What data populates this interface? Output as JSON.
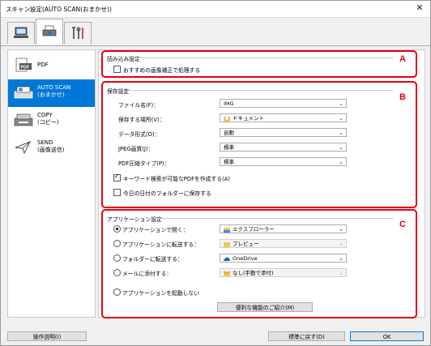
{
  "window": {
    "title": "スキャン設定(AUTO SCAN(おまかせ))",
    "close_glyph": "✕"
  },
  "tabs": [
    {
      "icon": "scanner-to-pc-icon",
      "active": false
    },
    {
      "icon": "scan-from-operation-panel-icon",
      "active": true
    },
    {
      "icon": "tools-icon",
      "active": false
    }
  ],
  "sidebar": {
    "items": [
      {
        "label": "PDF",
        "icon": "pdf-icon",
        "selected": false
      },
      {
        "label": "AUTO SCAN\n(おまかせ)",
        "icon": "auto-scan-icon",
        "selected": true
      },
      {
        "label": "COPY\n(コピー)",
        "icon": "copy-icon",
        "selected": false
      },
      {
        "label": "SEND\n(画像送信)",
        "icon": "send-icon",
        "selected": false
      }
    ]
  },
  "scan_options": {
    "title": "読み込み設定",
    "recommended_correction": {
      "label": "おすすめの画像補正で処理する",
      "checked": false
    },
    "marker": "A"
  },
  "save_settings": {
    "title": "保存設定",
    "marker": "B",
    "fields": {
      "file_name": {
        "label": "ファイル名(F)：",
        "value": "IMG"
      },
      "save_in": {
        "label": "保存する場所(V)：",
        "value": "ドキュメント",
        "icon": "documents-folder-icon"
      },
      "data_format": {
        "label": "データ形式(O)：",
        "value": "自動"
      },
      "jpeg_quality": {
        "label": "JPEG画質(J)：",
        "value": "標準"
      },
      "pdf_compression": {
        "label": "PDF圧縮タイプ(P)：",
        "value": "標準"
      }
    },
    "keyword_pdf": {
      "label": "キーワード検索が可能なPDFを作成する(A)",
      "checked": true
    },
    "date_subfolder": {
      "label": "今日の日付のフォルダーに保存する",
      "checked": false
    }
  },
  "app_settings": {
    "title": "アプリケーション設定",
    "marker": "C",
    "options": [
      {
        "label": "アプリケーションで開く：",
        "value": "エクスプローラー",
        "icon": "explorer-icon",
        "checked": true,
        "disabled": false
      },
      {
        "label": "アプリケーションに転送する：",
        "value": "プレビュー",
        "icon": "folder-icon",
        "checked": false,
        "disabled": true
      },
      {
        "label": "フォルダーに転送する：",
        "value": "OneDrive",
        "icon": "onedrive-icon",
        "checked": false,
        "disabled": false
      },
      {
        "label": "メールに添付する：",
        "value": "なし(手動で添付)",
        "icon": "mail-icon",
        "checked": false,
        "disabled": true
      },
      {
        "label": "アプリケーションを起動しない",
        "value": null,
        "checked": false,
        "disabled": false
      }
    ],
    "more_functions_button": "便利な機能のご紹介(M)"
  },
  "footer": {
    "help_button": "操作説明(I)",
    "defaults_button": "標準に戻す(D)",
    "ok_button": "OK"
  },
  "colors": {
    "accent": "#0078d7",
    "callout_red": "#e60012"
  }
}
